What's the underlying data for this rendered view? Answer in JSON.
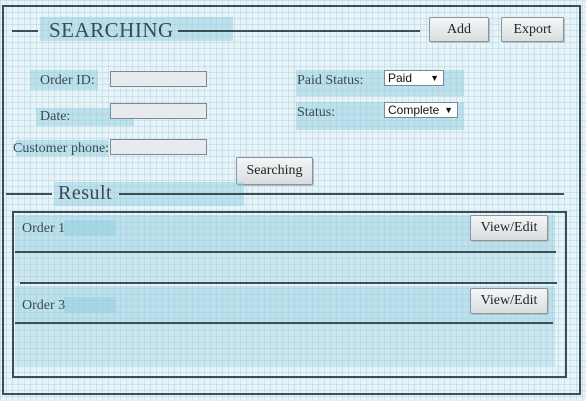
{
  "header": {
    "title": "SEARCHING",
    "add_label": "Add",
    "export_label": "Export"
  },
  "filters": {
    "order_id_label": "Order ID:",
    "order_id_value": "",
    "date_label": "Date:",
    "date_value": "",
    "customer_phone_label": "Customer phone:",
    "customer_phone_value": "",
    "paid_status_label": "Paid Status:",
    "paid_status_value": "Paid",
    "status_label": "Status:",
    "status_value": "Complete",
    "search_button_label": "Searching"
  },
  "results": {
    "title": "Result",
    "orders": [
      {
        "label": "Order 1",
        "action_label": "View/Edit"
      },
      {
        "label": "Order 3",
        "action_label": "View/Edit"
      }
    ]
  },
  "icons": {
    "dropdown": "caret-down-icon"
  }
}
